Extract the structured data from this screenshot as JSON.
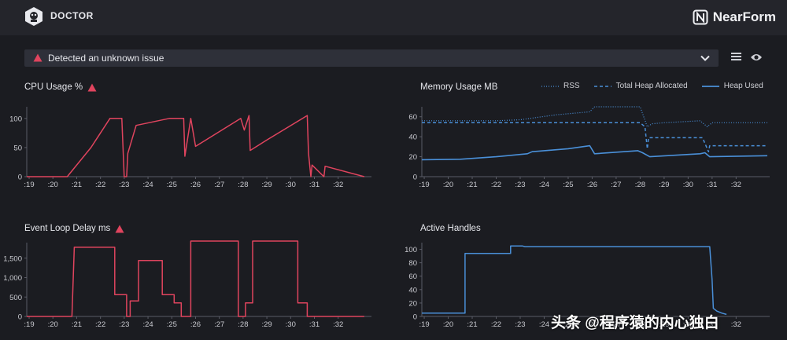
{
  "header": {
    "app_title": "DOCTOR",
    "brand": "NearForm"
  },
  "alert": {
    "text": "Detected an unknown issue",
    "color": "#e0445e"
  },
  "toolbar": {
    "list_icon": "list-icon",
    "eye_icon": "eye-icon"
  },
  "colors": {
    "cpu": "#e0445e",
    "memory": "#4a90d9",
    "accent_alert": "#e0445e"
  },
  "panels": {
    "cpu": {
      "title": "CPU Usage %"
    },
    "memory": {
      "title": "Memory Usage MB"
    },
    "delay": {
      "title": "Event Loop Delay ms"
    },
    "handles": {
      "title": "Active Handles"
    }
  },
  "memory_legend": [
    "RSS",
    "Total Heap Allocated",
    "Heap Used"
  ],
  "watermark": "头条 @程序猿的内心独白",
  "chart_data": [
    {
      "type": "line",
      "id": "cpu",
      "title": "CPU Usage %",
      "xticks": [
        ":19",
        ":20",
        ":21",
        ":22",
        ":23",
        ":24",
        ":25",
        ":26",
        ":27",
        ":28",
        ":29",
        ":30",
        ":31",
        ":32"
      ],
      "yticks": [
        "0",
        "50",
        "100"
      ],
      "ylim": [
        0,
        120
      ],
      "xlim": [
        18.9,
        33.4
      ],
      "series": [
        {
          "x": [
            18.9,
            20.6,
            21.6,
            22.4,
            22.9,
            23.0,
            23.1,
            23.15,
            23.5,
            24.9,
            25.5,
            25.55,
            25.8,
            26.0,
            27.9,
            28.05,
            28.25,
            28.3,
            29.0,
            30.7,
            30.75,
            30.85,
            30.9,
            31.4,
            31.45,
            33.1
          ],
          "y": [
            0,
            0,
            50,
            100,
            100,
            0,
            0,
            40,
            88,
            100,
            100,
            35,
            100,
            52,
            100,
            80,
            105,
            45,
            63,
            105,
            40,
            0,
            20,
            0,
            18,
            0
          ]
        }
      ]
    },
    {
      "type": "line",
      "id": "memory",
      "title": "Memory Usage MB",
      "xticks": [
        ":19",
        ":20",
        ":21",
        ":22",
        ":23",
        ":24",
        ":25",
        ":26",
        ":27",
        ":28",
        ":29",
        ":30",
        ":31",
        ":32"
      ],
      "yticks": [
        "0",
        "20",
        "40",
        "60"
      ],
      "ylim": [
        0,
        70
      ],
      "xlim": [
        18.9,
        33.4
      ],
      "series": [
        {
          "name": "RSS",
          "x": [
            18.9,
            20.5,
            22.0,
            23.0,
            24.5,
            25.9,
            26.1,
            28.0,
            28.3,
            28.5,
            29.0,
            30.5,
            30.8,
            31.0,
            33.3
          ],
          "y": [
            56,
            56,
            56,
            57,
            62,
            65,
            70,
            70,
            50,
            53,
            54,
            56,
            50,
            54,
            54
          ]
        },
        {
          "name": "Total Heap Allocated",
          "x": [
            18.9,
            28.0,
            28.2,
            28.3,
            28.35,
            30.6,
            30.85,
            30.9,
            33.3
          ],
          "y": [
            54,
            54,
            50,
            28,
            39,
            39,
            25,
            31,
            31
          ]
        },
        {
          "name": "Heap Used",
          "x": [
            18.9,
            20.5,
            22.0,
            23.3,
            23.5,
            25.0,
            25.9,
            26.1,
            27.9,
            28.1,
            28.4,
            30.5,
            30.7,
            30.9,
            33.3
          ],
          "y": [
            17,
            17.5,
            20,
            23,
            25,
            28,
            31,
            23,
            26,
            24,
            20,
            23,
            24,
            20,
            21
          ]
        }
      ]
    },
    {
      "type": "line",
      "id": "delay",
      "title": "Event Loop Delay ms",
      "xticks": [
        ":19",
        ":20",
        ":21",
        ":22",
        ":23",
        ":24",
        ":25",
        ":26",
        ":27",
        ":28",
        ":29",
        ":30",
        ":31",
        ":32"
      ],
      "yticks": [
        "0",
        "500",
        "1,000",
        "1,500"
      ],
      "ylim": [
        0,
        1900
      ],
      "xlim": [
        18.9,
        33.4
      ],
      "series": [
        {
          "x": [
            18.9,
            20.8,
            20.8,
            20.9,
            20.9,
            22.6,
            22.6,
            23.1,
            23.1,
            23.25,
            23.25,
            23.6,
            23.6,
            24.1,
            24.1,
            24.6,
            24.6,
            25.1,
            25.1,
            25.4,
            25.4,
            25.8,
            25.8,
            25.9,
            25.9,
            27.0,
            27.0,
            27.8,
            27.8,
            28.1,
            28.1,
            28.4,
            28.4,
            30.0,
            30.0,
            30.3,
            30.3,
            30.7,
            30.7,
            33.1
          ],
          "y": [
            0,
            0,
            0,
            1780,
            1780,
            1780,
            560,
            560,
            0,
            0,
            400,
            400,
            1440,
            1440,
            1440,
            1440,
            560,
            560,
            350,
            350,
            0,
            0,
            1940,
            1940,
            1940,
            1940,
            1940,
            1940,
            0,
            0,
            350,
            350,
            1940,
            1940,
            1940,
            1940,
            350,
            350,
            0,
            0
          ]
        }
      ]
    },
    {
      "type": "line",
      "id": "handles",
      "title": "Active Handles",
      "xticks": [
        ":19",
        ":20",
        ":21",
        ":22",
        ":23",
        ":24",
        ":25",
        ":26",
        ":27",
        ":28",
        ":29",
        ":30",
        ":31",
        ":32"
      ],
      "yticks": [
        "0",
        "20",
        "40",
        "60",
        "80",
        "100"
      ],
      "ylim": [
        0,
        110
      ],
      "xlim": [
        18.9,
        33.4
      ],
      "series": [
        {
          "x": [
            18.9,
            20.7,
            20.7,
            22.6,
            22.6,
            23.1,
            23.2,
            30.9,
            31.0,
            31.05,
            31.2,
            31.4,
            31.6
          ],
          "y": [
            5,
            5,
            94,
            94,
            105,
            105,
            104,
            104,
            55,
            12,
            8,
            5,
            3
          ]
        }
      ]
    }
  ]
}
